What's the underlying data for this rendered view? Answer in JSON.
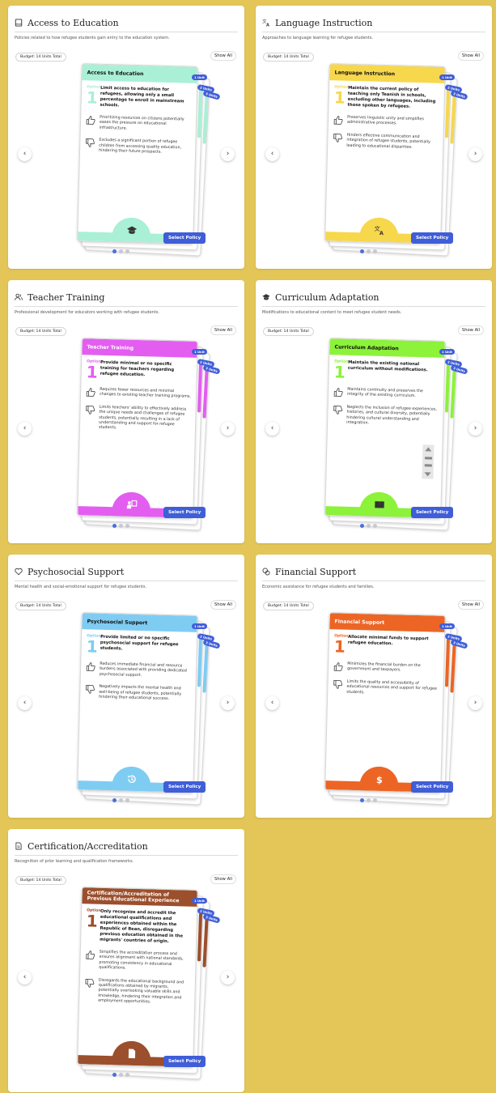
{
  "panels": [
    {
      "title": "Access to Education",
      "description": "Policies related to how refugee students gain entry to the education system.",
      "budget": "Budget: 14 Units Total",
      "show_all": "Show All",
      "icon": "book-icon",
      "accent": "#a9f0d6",
      "card": {
        "header": "Access to Education",
        "option_label": "Option",
        "option_number": "1",
        "option_text": "Limit access to education for refugees, allowing only a small percentage to enroll in mainstream schools.",
        "pro": "Prioritizing resources on citizens potentially eases the pressure on educational infrastructure.",
        "con": "Excludes a significant portion of refugee children from accessing quality education, hindering their future prospects.",
        "footer_icon": "graduation-cap-icon",
        "select_label": "Select Policy"
      },
      "unit_tabs": [
        "1 Unit",
        "2 Units",
        "3 Units"
      ]
    },
    {
      "title": "Language Instruction",
      "description": "Approaches to language learning for refugee students.",
      "budget": "Budget: 14 Units Total",
      "show_all": "Show All",
      "icon": "translate-icon",
      "accent": "#f7d74c",
      "card": {
        "header": "Language Instruction",
        "option_label": "Option",
        "option_number": "1",
        "option_text": "Maintain the current policy of teaching only Teanish in schools, excluding other languages, including those spoken by refugees.",
        "pro": "Preserves linguistic unity and simplifies administrative processes.",
        "con": "Hinders effective communication and integration of refugee students, potentially leading to educational disparities.",
        "footer_icon": "translate-icon",
        "select_label": "Select Policy"
      },
      "unit_tabs": [
        "1 Unit",
        "2 Units",
        "3 Units"
      ]
    },
    {
      "title": "Teacher Training",
      "description": "Professional development for educators working with refugee students.",
      "budget": "Budget: 14 Units Total",
      "show_all": "Show All",
      "icon": "users-icon",
      "accent": "#e35ef0",
      "card": {
        "header": "Teacher Training",
        "option_label": "Option",
        "option_number": "1",
        "option_text": "Provide minimal or no specific training for teachers regarding refugee education.",
        "pro": "Requires fewer resources and minimal changes to existing teacher training programs.",
        "con": "Limits teachers' ability to effectively address the unique needs and challenges of refugee students, potentially resulting in a lack of understanding and support for refugee students.",
        "footer_icon": "teacher-board-icon",
        "select_label": "Select Policy"
      },
      "unit_tabs": [
        "1 Unit",
        "2 Units",
        "3 Units"
      ]
    },
    {
      "title": "Curriculum Adaptation",
      "description": "Modifications to educational content to meet refugee student needs.",
      "budget": "Budget: 14 Units Total",
      "show_all": "Show All",
      "icon": "graduation-cap-icon",
      "accent": "#8cf23a",
      "card": {
        "header": "Curriculum Adaptation",
        "option_label": "Option",
        "option_number": "1",
        "option_text": "Maintain the existing national curriculum without modifications.",
        "pro": "Maintains continuity and preserves the integrity of the existing curriculum.",
        "con": "Neglects the inclusion of refugee experiences, histories, and cultural diversity, potentially hindering cultural understanding and integration.",
        "footer_icon": "open-book-icon",
        "select_label": "Select Policy"
      },
      "unit_tabs": [
        "1 Unit",
        "2 Units",
        "3 Units"
      ]
    },
    {
      "title": "Psychosocial Support",
      "description": "Mental health and social-emotional support for refugee students.",
      "budget": "Budget: 14 Units Total",
      "show_all": "Show All",
      "icon": "heart-icon",
      "accent": "#7fccf3",
      "card": {
        "header": "Psychosocial Support",
        "option_label": "Option",
        "option_number": "1",
        "option_text": "Provide limited or no specific psychosocial support for refugee students.",
        "pro": "Reduces immediate financial and resource burdens associated with providing dedicated psychosocial support.",
        "con": "Negatively impacts the mental health and well-being of refugee students, potentially hindering their educational success.",
        "footer_icon": "history-icon",
        "select_label": "Select Policy"
      },
      "unit_tabs": [
        "1 Unit",
        "2 Units",
        "3 Units"
      ]
    },
    {
      "title": "Financial Support",
      "description": "Economic assistance for refugee students and families.",
      "budget": "Budget: 14 Units Total",
      "show_all": "Show All",
      "icon": "coins-icon",
      "accent": "#ec6525",
      "card": {
        "header": "Financial Support",
        "option_label": "Option",
        "option_number": "1",
        "option_text": "Allocate minimal funds to support refugee education.",
        "pro": "Minimizes the financial burden on the government and taxpayers.",
        "con": "Limits the quality and accessibility of educational resources and support for refugee students.",
        "footer_icon": "dollar-icon",
        "select_label": "Select Policy"
      },
      "unit_tabs": [
        "1 Unit",
        "2 Units",
        "3 Units"
      ]
    },
    {
      "title": "Certification/Accreditation",
      "description": "Recognition of prior learning and qualification frameworks.",
      "budget": "Budget: 14 Units Total",
      "show_all": "Show All",
      "icon": "certificate-icon",
      "accent": "#9b4f2c",
      "card": {
        "header": "Certification/Accreditation of Previous Educational Experience",
        "option_label": "Option",
        "option_number": "1",
        "option_text": "Only recognize and accredit the educational qualifications and experiences obtained within the Republic of Bean, disregarding previous education obtained in the migrants' countries of origin.",
        "pro": "Simplifies the accreditation process and ensures alignment with national standards, promoting consistency in educational qualifications.",
        "con": "Disregards the educational background and qualifications obtained by migrants, potentially overlooking valuable skills and knowledge, hindering their integration and employment opportunities.",
        "footer_icon": "document-icon",
        "select_label": "Select Policy"
      },
      "unit_tabs": [
        "1 Unit",
        "2 Units",
        "3 Units"
      ]
    }
  ],
  "nav": {
    "prev": "‹",
    "next": "›"
  }
}
